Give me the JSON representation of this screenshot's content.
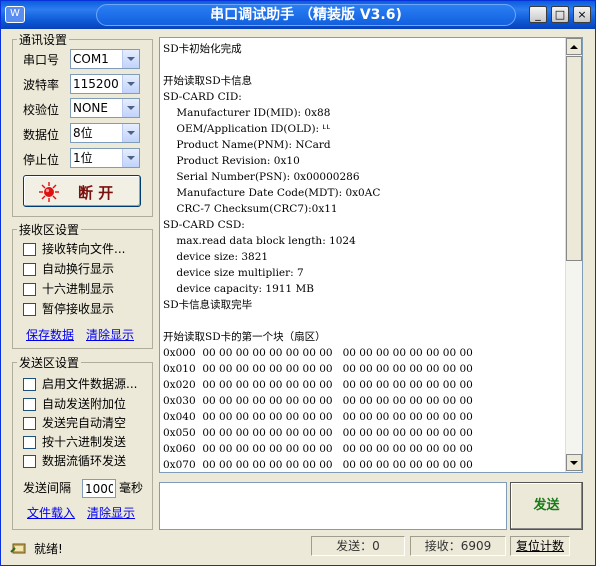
{
  "window": {
    "title": "串口调试助手 （精装版 V3.6)",
    "sysmenu_glyph": "W",
    "min": "_",
    "max": "□",
    "close": "×"
  },
  "comm": {
    "title": "通讯设置",
    "port_label": "串口号",
    "port_value": "COM1",
    "baud_label": "波特率",
    "baud_value": "115200",
    "parity_label": "校验位",
    "parity_value": "NONE",
    "databits_label": "数据位",
    "databits_value": "8位",
    "stopbits_label": "停止位",
    "stopbits_value": "1位",
    "open_button_label": "断 开",
    "indicator_color": "#e01010"
  },
  "recv_settings": {
    "title": "接收区设置",
    "options": [
      "接收转向文件...",
      "自动换行显示",
      "十六进制显示",
      "暂停接收显示"
    ],
    "save_link": "保存数据",
    "clear_link": "清除显示"
  },
  "send_settings": {
    "title": "发送区设置",
    "options": [
      "启用文件数据源...",
      "自动发送附加位",
      "发送完自动清空",
      "按十六进制发送",
      "数据流循环发送"
    ],
    "interval_label": "发送间隔",
    "interval_value": "1000",
    "interval_unit": "毫秒",
    "load_link": "文件载入",
    "clear_link": "清除显示"
  },
  "receive_text": [
    "SD卡初始化完成",
    "",
    "开始读取SD卡信息",
    "SD-CARD CID:",
    "    Manufacturer ID(MID): 0x88",
    "    OEM/Application ID(OLD): ᒻᒻ",
    "    Product Name(PNM): NCard",
    "    Product Revision: 0x10",
    "    Serial Number(PSN): 0x00000286",
    "    Manufacture Date Code(MDT): 0x0AC",
    "    CRC-7 Checksum(CRC7):0x11",
    "SD-CARD CSD:",
    "    max.read data block length: 1024",
    "    device size: 3821",
    "    device size multiplier: 7",
    "    device capacity: 1911 MB",
    "SD卡信息读取完毕",
    "",
    "开始读取SD卡的第一个块（扇区）",
    "0x000  00 00 00 00 00 00 00 00   00 00 00 00 00 00 00 00",
    "0x010  00 00 00 00 00 00 00 00   00 00 00 00 00 00 00 00",
    "0x020  00 00 00 00 00 00 00 00   00 00 00 00 00 00 00 00",
    "0x030  00 00 00 00 00 00 00 00   00 00 00 00 00 00 00 00",
    "0x040  00 00 00 00 00 00 00 00   00 00 00 00 00 00 00 00",
    "0x050  00 00 00 00 00 00 00 00   00 00 00 00 00 00 00 00",
    "0x060  00 00 00 00 00 00 00 00   00 00 00 00 00 00 00 00",
    "0x070  00 00 00 00 00 00 00 00   00 00 00 00 00 00 00 00"
  ],
  "send_button_label": "发送",
  "status": {
    "ready": "就绪!",
    "sent": "发送：0",
    "received": "接收：6909",
    "reset_label": "复位计数"
  }
}
